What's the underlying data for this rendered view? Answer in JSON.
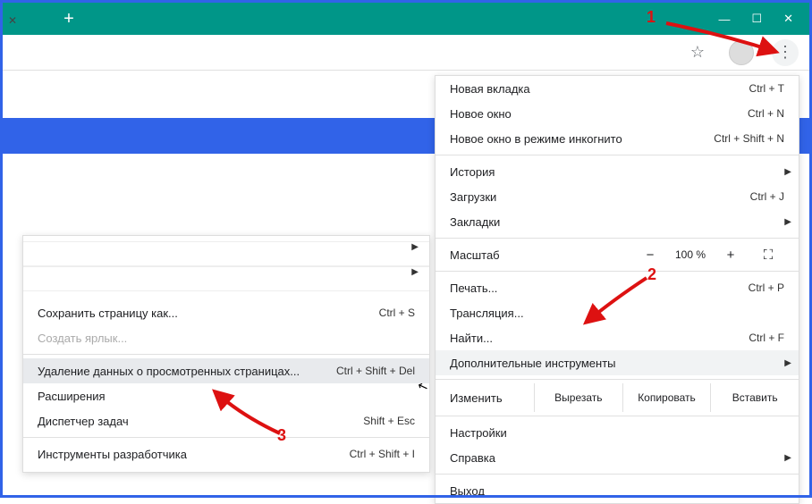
{
  "window": {
    "minimize": "—",
    "maximize": "☐",
    "close": "✕"
  },
  "tabs": {
    "close_icon": "✕",
    "new_tab": "+"
  },
  "toolbar": {
    "star": "☆",
    "menu": "⋮"
  },
  "annotations": {
    "n1": "1",
    "n2": "2",
    "n3": "3"
  },
  "main_menu": {
    "new_tab": {
      "label": "Новая вкладка",
      "shortcut": "Ctrl + T"
    },
    "new_window": {
      "label": "Новое окно",
      "shortcut": "Ctrl + N"
    },
    "incognito": {
      "label": "Новое окно в режиме инкогнито",
      "shortcut": "Ctrl + Shift + N"
    },
    "history": {
      "label": "История"
    },
    "downloads": {
      "label": "Загрузки",
      "shortcut": "Ctrl + J"
    },
    "bookmarks": {
      "label": "Закладки"
    },
    "zoom": {
      "label": "Масштаб",
      "minus": "−",
      "pct": "100 %",
      "plus": "+"
    },
    "print": {
      "label": "Печать...",
      "shortcut": "Ctrl + P"
    },
    "cast": {
      "label": "Трансляция..."
    },
    "find": {
      "label": "Найти...",
      "shortcut": "Ctrl + F"
    },
    "more_tools": {
      "label": "Дополнительные инструменты"
    },
    "edit": {
      "label": "Изменить",
      "cut": "Вырезать",
      "copy": "Копировать",
      "paste": "Вставить"
    },
    "settings": {
      "label": "Настройки"
    },
    "help": {
      "label": "Справка"
    },
    "exit": {
      "label": "Выход"
    }
  },
  "sub_menu": {
    "save_as": {
      "label": "Сохранить страницу как...",
      "shortcut": "Ctrl + S"
    },
    "create_shortcut": {
      "label": "Создать ярлык..."
    },
    "clear_data": {
      "label": "Удаление данных о просмотренных страницах...",
      "shortcut": "Ctrl + Shift + Del"
    },
    "extensions": {
      "label": "Расширения"
    },
    "task_manager": {
      "label": "Диспетчер задач",
      "shortcut": "Shift + Esc"
    },
    "dev_tools": {
      "label": "Инструменты разработчика",
      "shortcut": "Ctrl + Shift + I"
    }
  }
}
